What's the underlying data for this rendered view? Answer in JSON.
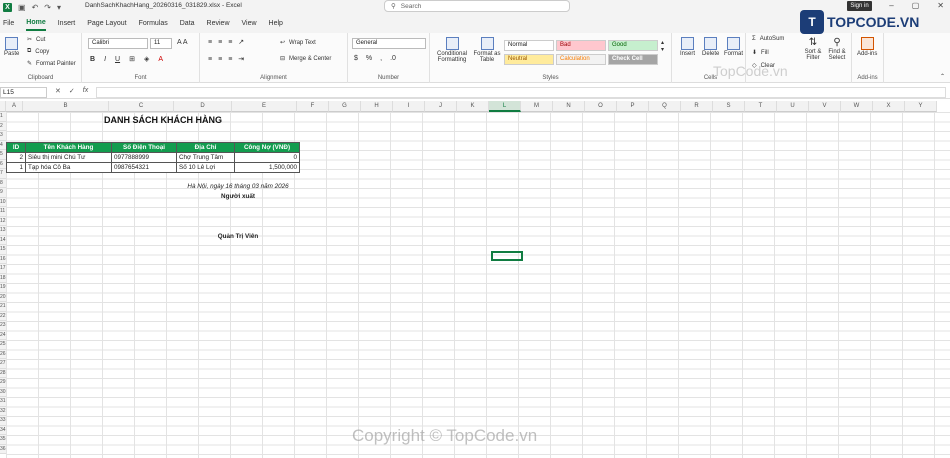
{
  "window": {
    "title": "DanhSachKhachHang_20260316_031829.xlsx - Excel",
    "search_placeholder": "Search",
    "signin_label": "Sign in"
  },
  "menu": [
    "File",
    "Home",
    "Insert",
    "Page Layout",
    "Formulas",
    "Data",
    "Review",
    "View",
    "Help"
  ],
  "ribbon": {
    "clipboard": {
      "paste": "Paste",
      "cut": "Cut",
      "copy": "Copy",
      "format_painter": "Format Painter",
      "label": "Clipboard"
    },
    "font": {
      "name": "Calibri",
      "size": "11",
      "label": "Font"
    },
    "alignment": {
      "wrap": "Wrap Text",
      "merge": "Merge & Center",
      "label": "Alignment"
    },
    "number": {
      "format": "General",
      "label": "Number"
    },
    "styles": {
      "conditional": "Conditional Formatting",
      "format_table": "Format as Table",
      "normal": "Normal",
      "bad": "Bad",
      "good": "Good",
      "neutral": "Neutral",
      "calculation": "Calculation",
      "check_cell": "Check Cell",
      "label": "Styles"
    },
    "cells": {
      "insert": "Insert",
      "delete": "Delete",
      "format": "Format",
      "label": "Cells"
    },
    "editing": {
      "autosum": "AutoSum",
      "fill": "Fill",
      "clear": "Clear",
      "sort": "Sort & Filter",
      "find": "Find & Select"
    },
    "addins": {
      "addins": "Add-ins",
      "label": "Add-ins"
    }
  },
  "formula_bar": {
    "name_box": "L15",
    "fx": "fx"
  },
  "columns": [
    "A",
    "B",
    "C",
    "D",
    "E",
    "F",
    "G",
    "H",
    "I",
    "J",
    "K",
    "L",
    "M",
    "N",
    "O",
    "P",
    "Q",
    "R",
    "S",
    "T",
    "U",
    "V",
    "W",
    "X",
    "Y"
  ],
  "selected_column": "L",
  "rows": [
    "1",
    "2",
    "3",
    "4",
    "5",
    "6",
    "7",
    "8",
    "9",
    "10",
    "11",
    "12",
    "13",
    "14",
    "15",
    "16",
    "17",
    "18",
    "19",
    "20",
    "21",
    "22",
    "23",
    "24",
    "25",
    "26",
    "27",
    "28",
    "29",
    "30",
    "31",
    "32",
    "33",
    "34",
    "35",
    "36"
  ],
  "sheet": {
    "title": "DANH SÁCH KHÁCH HÀNG",
    "headers": [
      "ID",
      "Tên Khách Hàng",
      "Số Điện Thoại",
      "Địa Chỉ",
      "Công Nợ (VNĐ)"
    ],
    "data": [
      [
        "2",
        "Siêu thị mini Chú Tư",
        "0977888999",
        "Chợ Trung Tâm",
        "0"
      ],
      [
        "1",
        "Tạp hóa Cô Ba",
        "0987654321",
        "Số 10 Lê Lợi",
        "1,500,000"
      ]
    ],
    "place_date": "Hà Nội, ngày 16 tháng 03 năm 2026",
    "creator": "Người xuất",
    "admin": "Quản Trị Viên"
  },
  "watermark": {
    "logo": "TOPCODE.VN",
    "small": "TopCode.vn",
    "copyright": "Copyright © TopCode.vn"
  }
}
